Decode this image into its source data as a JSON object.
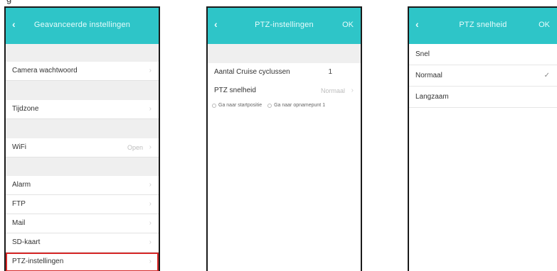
{
  "caption": "g",
  "screen1": {
    "back_label": "‹",
    "title": "Geavanceerde instellingen",
    "rows": [
      {
        "label": "Camera wachtwoord"
      },
      {
        "label": "Tijdzone"
      },
      {
        "label": "WiFi",
        "value": "Open"
      },
      {
        "label": "Alarm"
      },
      {
        "label": "FTP"
      },
      {
        "label": "Mail"
      },
      {
        "label": "SD-kaart"
      },
      {
        "label": "PTZ-instellingen",
        "highlighted": true
      }
    ],
    "chevron": "›"
  },
  "screen2": {
    "back_label": "‹",
    "title": "PTZ-instellingen",
    "ok_label": "OK",
    "cruise_label": "Aantal Cruise cyclussen",
    "cruise_value": "1",
    "speed_label": "PTZ snelheid",
    "speed_value": "Normaal",
    "radio1": "Ga naar startpositie",
    "radio2": "Ga naar opnamepunt 1",
    "chevron": "›"
  },
  "screen3": {
    "back_label": "‹",
    "title": "PTZ snelheid",
    "ok_label": "OK",
    "options": [
      {
        "label": "Snel",
        "selected": false
      },
      {
        "label": "Normaal",
        "selected": true
      },
      {
        "label": "Langzaam",
        "selected": false
      }
    ],
    "check": "✓"
  }
}
